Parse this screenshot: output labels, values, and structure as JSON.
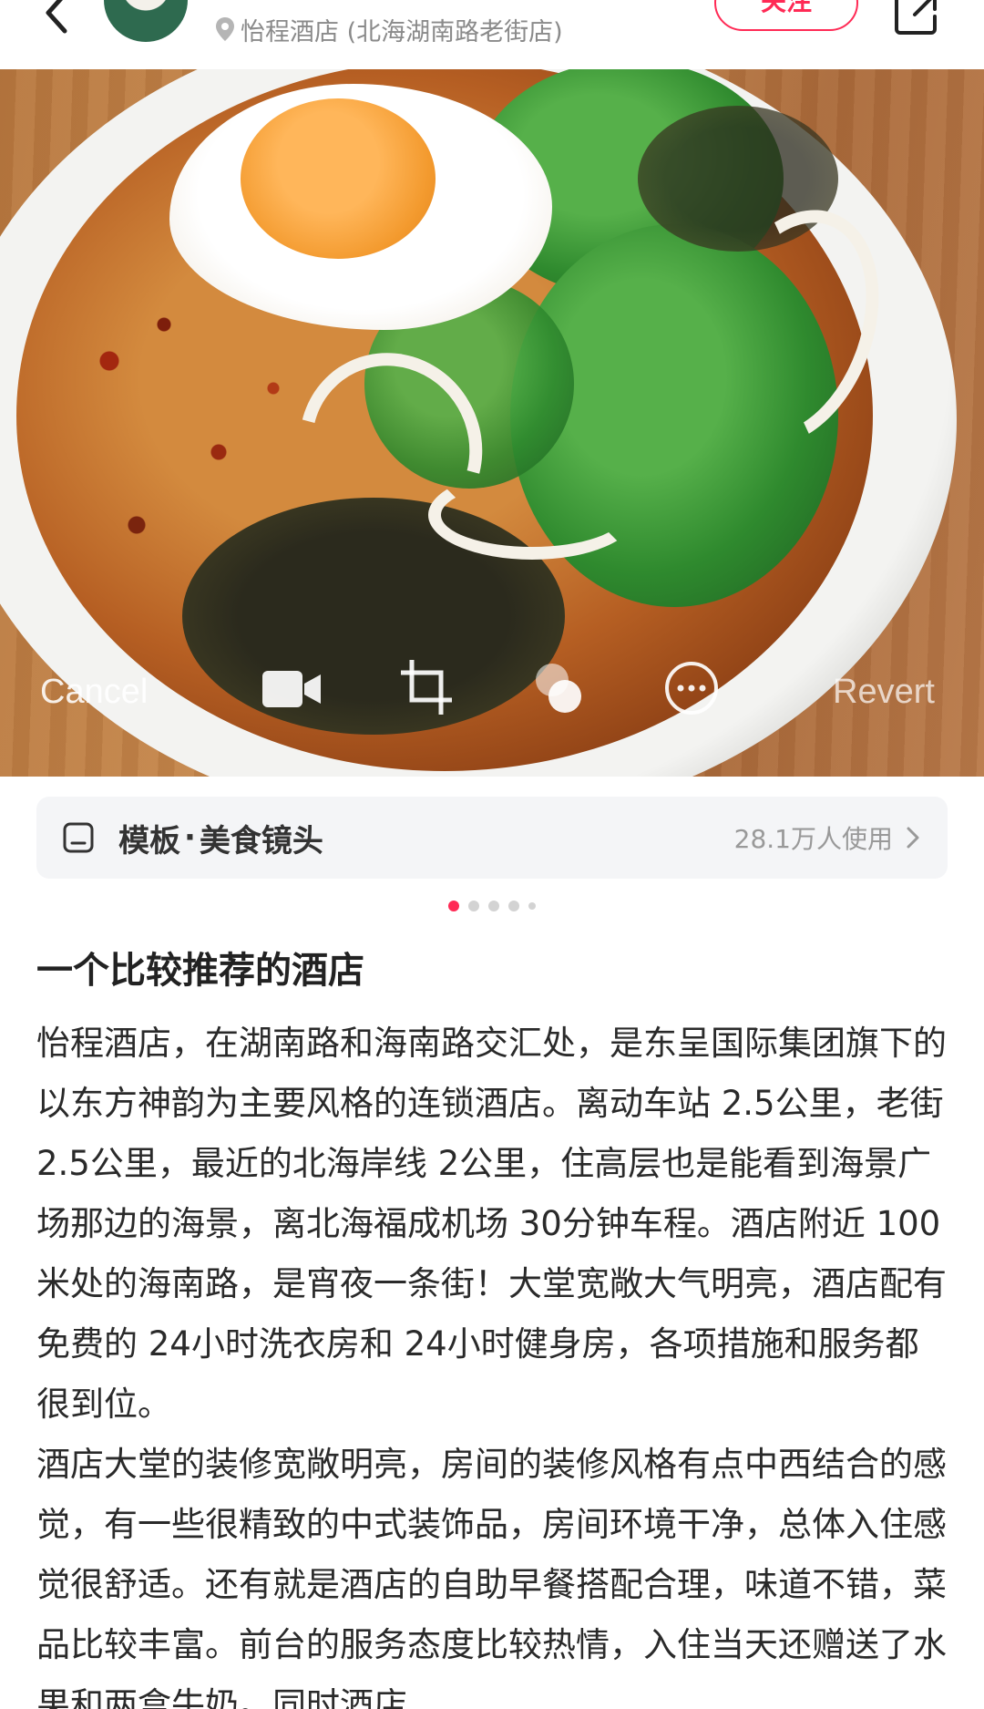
{
  "header": {
    "location_text": "怡程酒店 (北海湖南路老街店)",
    "follow_label": "关注"
  },
  "photo": {
    "overlay": {
      "cancel_label": "Cancel",
      "revert_label": "Revert"
    }
  },
  "template": {
    "label": "模板",
    "separator": "·",
    "name": "美食镜头",
    "usage": "28.1万人使用"
  },
  "pagination": {
    "total": 5,
    "active_index": 0
  },
  "note": {
    "title": "一个比较推荐的酒店",
    "paragraphs": [
      "怡程酒店，在湖南路和海南路交汇处，是东呈国际集团旗下的以东方神韵为主要风格的连锁酒店。离动车站 2.5公里，老街 2.5公里，最近的北海岸线 2公里，住高层也是能看到海景广场那边的海景，离北海福成机场 30分钟车程。酒店附近 100米处的海南路，是宵夜一条街！大堂宽敞大气明亮，酒店配有免费的 24小时洗衣房和 24小时健身房，各项措施和服务都很到位。",
      "酒店大堂的装修宽敞明亮，房间的装修风格有点中西结合的感觉，有一些很精致的中式装饰品，房间环境干净，总体入住感觉很舒适。还有就是酒店的自助早餐搭配合理，味道不错，菜品比较丰富。前台的服务态度比较热情，入住当天还赠送了水果和两盒牛奶。同时酒店"
    ]
  },
  "colors": {
    "accent": "#ff2a55",
    "muted_text": "#8a8a8a",
    "template_bg": "#f4f5f7"
  },
  "icons": {
    "back": "chevron-left-icon",
    "location": "location-pin-icon",
    "share": "share-icon",
    "template": "template-icon",
    "chevron": "chevron-right-icon",
    "video": "video-camera-icon",
    "crop": "crop-icon",
    "filters": "filters-icon",
    "more": "more-icon"
  }
}
